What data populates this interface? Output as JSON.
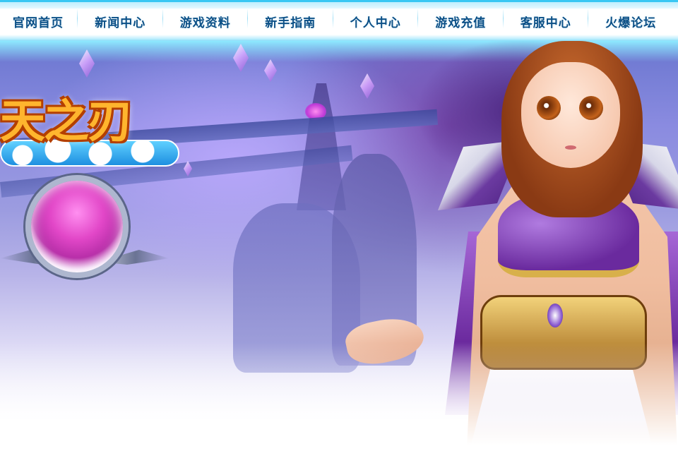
{
  "nav": {
    "items": [
      {
        "label": "官网首页"
      },
      {
        "label": "新闻中心"
      },
      {
        "label": "游戏资料"
      },
      {
        "label": "新手指南"
      },
      {
        "label": "个人中心"
      },
      {
        "label": "游戏充值"
      },
      {
        "label": "客服中心"
      },
      {
        "label": "火爆论坛"
      }
    ]
  },
  "banner": {
    "logo_text": "天之刃"
  },
  "colors": {
    "nav_text": "#0a4f86",
    "nav_border": "#38c7f3",
    "logo_fill": "#ffb52e",
    "logo_outline": "#b33f00"
  }
}
